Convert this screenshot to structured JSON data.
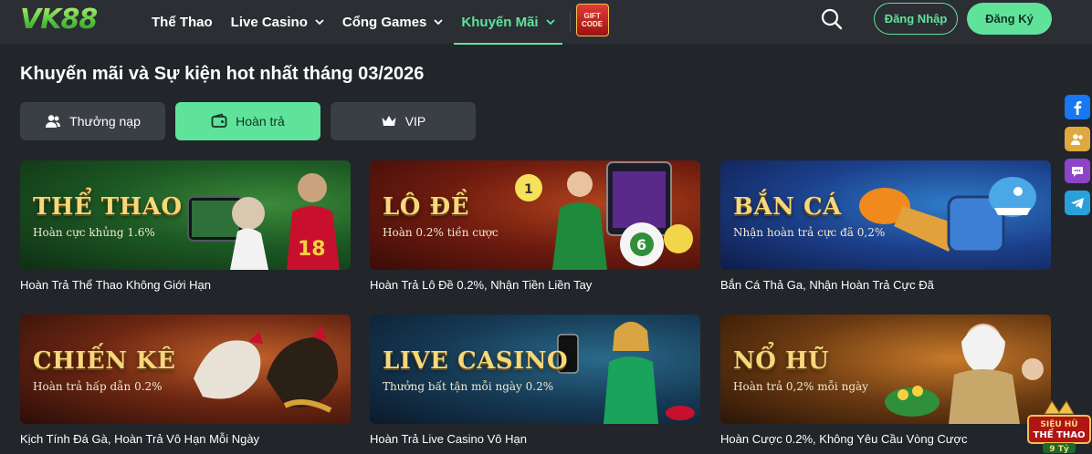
{
  "header": {
    "logo_text": "VK88",
    "nav": [
      {
        "label": "Thể Thao",
        "has_dropdown": false,
        "active": false
      },
      {
        "label": "Live Casino",
        "has_dropdown": true,
        "active": false
      },
      {
        "label": "Cổng Games",
        "has_dropdown": true,
        "active": false
      },
      {
        "label": "Khuyến Mãi",
        "has_dropdown": true,
        "active": true
      }
    ],
    "gift_code": {
      "line1": "GIFT",
      "line2": "CODE"
    },
    "login_label": "Đăng Nhập",
    "register_label": "Đăng Ký"
  },
  "page_title": "Khuyến mãi và Sự kiện hot nhất tháng 03/2026",
  "tabs": [
    {
      "label": "Thưởng nạp",
      "icon": "users-icon",
      "active": false
    },
    {
      "label": "Hoàn trả",
      "icon": "wallet-icon",
      "active": true
    },
    {
      "label": "VIP",
      "icon": "crown-icon",
      "active": false
    }
  ],
  "cards": [
    {
      "title": "THỂ THAO",
      "subtitle": "Hoàn cực khủng 1.6%",
      "caption": "Hoàn Trả Thể Thao Không Giới Hạn"
    },
    {
      "title": "LÔ ĐỀ",
      "subtitle": "Hoàn 0.2% tiền cược",
      "caption": "Hoàn Trả Lô Đề 0.2%, Nhận Tiền Liền Tay"
    },
    {
      "title": "BẮN CÁ",
      "subtitle": "Nhận hoàn trả cực đã 0,2%",
      "caption": "Bắn Cá Thả Ga, Nhận Hoàn Trả Cực Đã"
    },
    {
      "title": "CHIẾN KÊ",
      "subtitle": "Hoàn trả hấp dẫn 0.2%",
      "caption": "Kịch Tính Đá Gà, Hoàn Trả Vô Hạn Mỗi Ngày"
    },
    {
      "title": "LIVE CASINO",
      "subtitle": "Thưởng bất tận mỗi ngày 0.2%",
      "caption": "Hoàn Trả Live Casino Vô Hạn"
    },
    {
      "title": "NỔ HŨ",
      "subtitle": "Hoàn trả 0,2% mỗi ngày",
      "caption": "Hoàn Cược 0.2%, Không Yêu Cầu Vòng Cược"
    }
  ],
  "social": [
    "facebook-icon",
    "group-icon",
    "chat-icon",
    "telegram-icon"
  ],
  "corner_badge": {
    "line1": "SIÊU HŨ",
    "line2": "THỂ THAO",
    "line3": "9 Tỷ"
  },
  "colors": {
    "background": "#222529",
    "header": "#2b2e33",
    "accent": "#5fe39b",
    "tab_inactive": "#3a3e45",
    "banner_title": "#f6d77a"
  }
}
